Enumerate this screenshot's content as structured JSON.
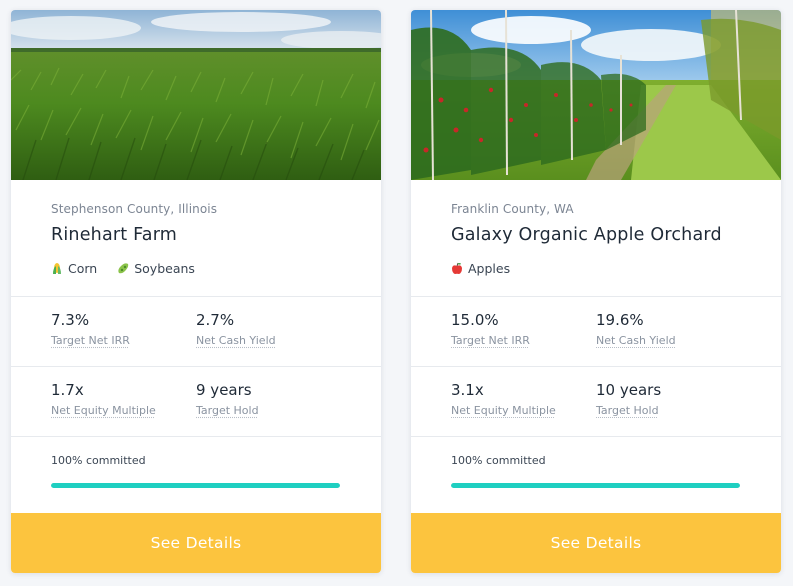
{
  "cards": [
    {
      "image": "cornfield-photo",
      "location": "Stephenson County, Illinois",
      "title": "Rinehart Farm",
      "crops": [
        {
          "icon": "corn-icon",
          "label": "Corn"
        },
        {
          "icon": "soybean-icon",
          "label": "Soybeans"
        }
      ],
      "stats": [
        {
          "value": "7.3%",
          "label": "Target Net IRR"
        },
        {
          "value": "2.7%",
          "label": "Net Cash Yield"
        },
        {
          "value": "1.7x",
          "label": "Net Equity Multiple"
        },
        {
          "value": "9 years",
          "label": "Target Hold"
        }
      ],
      "progress_text": "100% committed",
      "progress_fraction": 1.0,
      "button_label": "See Details"
    },
    {
      "image": "apple-orchard-photo",
      "location": "Franklin County, WA",
      "title": "Galaxy Organic Apple Orchard",
      "crops": [
        {
          "icon": "apple-icon",
          "label": "Apples"
        }
      ],
      "stats": [
        {
          "value": "15.0%",
          "label": "Target Net IRR"
        },
        {
          "value": "19.6%",
          "label": "Net Cash Yield"
        },
        {
          "value": "3.1x",
          "label": "Net Equity Multiple"
        },
        {
          "value": "10 years",
          "label": "Target Hold"
        }
      ],
      "progress_text": "100% committed",
      "progress_fraction": 1.0,
      "button_label": "See Details"
    }
  ],
  "colors": {
    "accent_button": "#fcc43e",
    "progress_fill": "#1fcfc1",
    "background": "#f4f6f9"
  }
}
